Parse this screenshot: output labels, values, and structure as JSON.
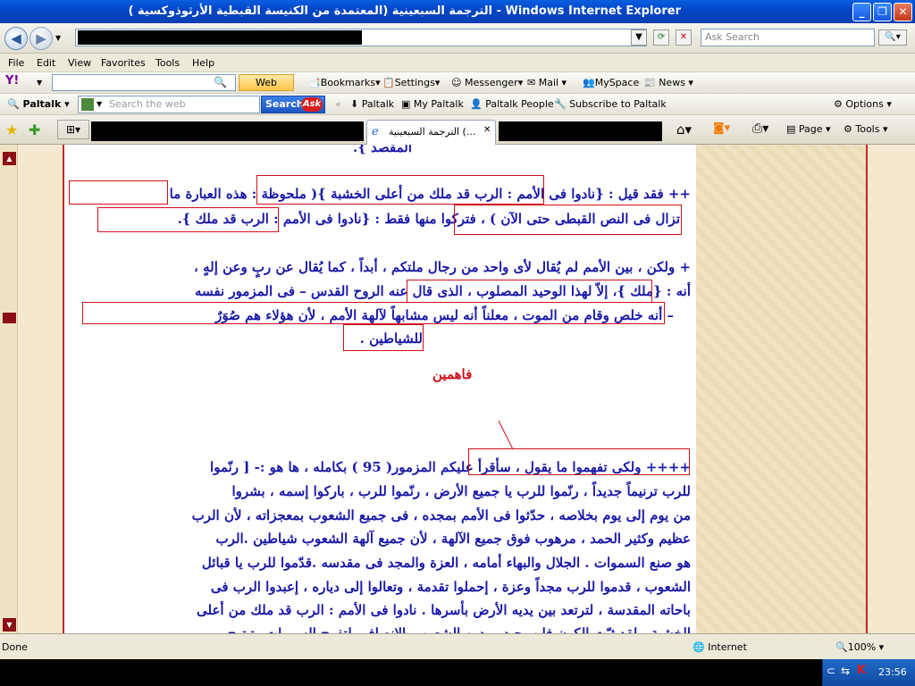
{
  "window": {
    "title": "الترجمة السبعينية (المعتمدة من الكنيسة القبطية الأرثوذوكسية ) - Windows Internet Explorer",
    "ask_search_placeholder": "Ask Search"
  },
  "menu": [
    "File",
    "Edit",
    "View",
    "Favorites",
    "Tools",
    "Help"
  ],
  "yahoo_toolbar": {
    "web_search": "Web Search",
    "bookmarks": "Bookmarks",
    "settings": "Settings",
    "messenger": "Messenger",
    "mail": "Mail",
    "myspace": "MySpace",
    "news": "News"
  },
  "paltalk_toolbar": {
    "brand": "Paltalk",
    "search_placeholder": "Search the web",
    "search_button": "Search",
    "ask_label": "Ask",
    "items": [
      "Paltalk",
      "My Paltalk",
      "Paltalk People",
      "Subscribe to Paltalk"
    ],
    "options": "Options"
  },
  "tabs": {
    "active_label": "الترجمة السبعينية (...",
    "page_menu": "Page",
    "tools_menu": "Tools"
  },
  "content": {
    "top_fragment": "المقصد }.",
    "p1_line1": "++ فقد قيل : {نادوا فى الأمم : الرب قد ملك من أعلى الخشبة }( ملحوظة : هذه العبارة ما",
    "p1_line2": "تزال فى النص القبطى حتى الآن ) ، فتركوا منها فقط : {نادوا فى الأمم : الرب قد ملك }.",
    "p2_line1": "+ ولكن ، بين الأمم لم يُقال لأى واحد من رجال ملتكم ، أبداً ، كما يُقال عن ربٍ وعن إلهٍ ،",
    "p2_line2": "أنه : {ملك }، إلاّ لهذا الوحيد المصلوب ، الذى قال عنه الروح القدس – فى المزمور نفسه",
    "p2_line3": "– أنه خلص وقام من الموت ، معلناً أنه ليس مشابهاً لآلهة الأمم ، لأن هؤلاء هم صُوَرٌ",
    "p2_line4": "للشياطين .",
    "note": "فاهمين",
    "p3_line1": "++++ ولكى تفهموا ما يقول ، سأقرأ عليكم المزمور( 95 ) بكامله ، ها هو :- [ رنّموا",
    "p3_line2": "للرب ترنيماً جديداً ، رنّموا للرب يا جميع الأرض ، رنّموا للرب ، باركوا إسمه ، بشروا",
    "p3_line3": "من يوم إلى يوم بخلاصه ، حدّثوا فى الأمم بمجده ، فى جميع الشعوب بمعجزاته ، لأن الرب",
    "p3_line4": "عظيم وكثير الحمد ، مرهوب فوق جميع الآلهة ، لأن جميع آلهة الشعوب شياطين .الرب",
    "p3_line5": "هو صنع السموات . الجلال والبهاء أمامه ، العزة والمجد فى مقدسه .قدّموا للرب يا قبائل",
    "p3_line6": "الشعوب ، قدموا للرب مجداً وعزة ، إحملوا تقدمة ، وتعالوا إلى دياره ، إعبدوا الرب فى",
    "p3_line7": "باحاته المقدسة ، لترتعد بين يديه الأرض بأسرها . نادوا فى الأمم : الرب قد ملك من أعلى",
    "p3_line8": "الخشبة ، لقد ثبّت الكون فلن يحيد ، يدين الشعوب بالانصاف. لتفرح السموات وتبتهج"
  },
  "status": {
    "left": "Done",
    "zone": "Internet",
    "zoom": "100%"
  },
  "taskbar": {
    "clock": "23:56"
  },
  "colors": {
    "content_text": "#1a1aa8",
    "annotation_red": "#d0101a",
    "title_bar": "#0a5fe0"
  }
}
